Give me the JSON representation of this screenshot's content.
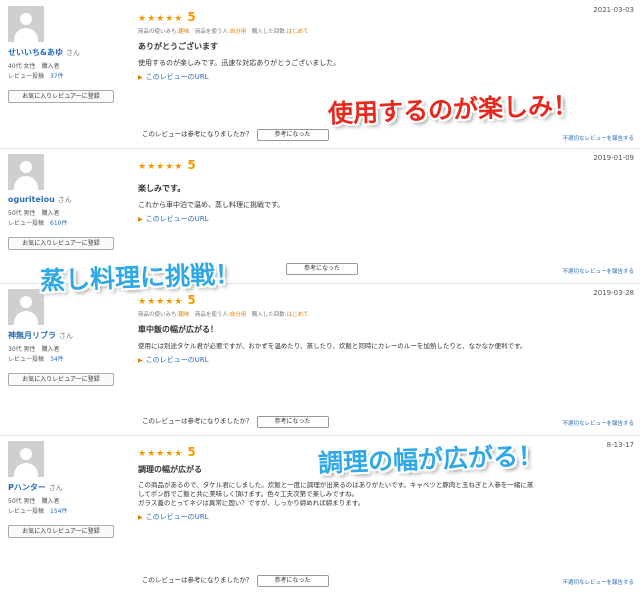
{
  "reviews": [
    {
      "user": "せいいち&あゆ",
      "san": "さん",
      "demo": "40代 女性　購入者",
      "posts_label": "レビュー投稿",
      "posts_count": "37件",
      "fav_button": "お気に入りレビュアーに登録",
      "stars": "★★★★★",
      "score": "5",
      "date": "2021-03-03",
      "usage_a": "商品の使いみち:",
      "usage_a_val": "趣味",
      "usage_b": "商品を使う人:",
      "usage_b_val": "自分用",
      "usage_c": "購入した回数:",
      "usage_c_val": "はじめて",
      "title": "ありがとうございます",
      "body": "使用するのが楽しみです。迅速な対応ありがとうございました。",
      "url_label": "このレビューのURL",
      "helpful_q": "このレビューは参考になりましたか？",
      "helpful_btn": "参考になった",
      "report": "不適切なレビューを報告する"
    },
    {
      "user": "oguriteiou",
      "san": "さん",
      "demo": "50代 男性　購入者",
      "posts_label": "レビュー投稿",
      "posts_count": "610件",
      "fav_button": "お気に入りレビュアーに登録",
      "stars": "★★★★★",
      "score": "5",
      "date": "2019-01-09",
      "title": "楽しみです。",
      "body": "これから車中泊で温め、蒸し料理に挑戦です。",
      "url_label": "このレビューのURL",
      "helpful_btn": "参考になった",
      "report": "不適切なレビューを報告する"
    },
    {
      "user": "神無月リブラ",
      "san": "さん",
      "demo": "30代 男性　購入者",
      "posts_label": "レビュー投稿",
      "posts_count": "34件",
      "fav_button": "お気に入りレビュアーに登録",
      "stars": "★★★★★",
      "score": "5",
      "date": "2019-03-28",
      "usage_a": "商品の使いみち:",
      "usage_a_val": "趣味",
      "usage_b": "商品を使う人:",
      "usage_b_val": "自分用",
      "usage_c": "購入した回数:",
      "usage_c_val": "はじめて",
      "title": "車中飯の幅が広がる！",
      "body": "使用には別途タケル君が必要ですが、おかずを温めたり、蒸したり、炊飯と同時にカレーのルーを加熱したりと、なかなか便利です。",
      "url_label": "このレビューのURL",
      "helpful_q": "このレビューは参考になりましたか？",
      "helpful_btn": "参考になった",
      "report": "不適切なレビューを報告する"
    },
    {
      "user": "Pハンター",
      "san": "さん",
      "demo": "50代 男性　購入者",
      "posts_label": "レビュー投稿",
      "posts_count": "154件",
      "fav_button": "お気に入りレビュアーに登録",
      "stars": "★★★★★",
      "score": "5",
      "date": "8-13-17",
      "title": "調理の幅が広がる",
      "body_lines": [
        "この商品があるので、タケル君にしました。炊飯と一度に調理が出来るのはありがたいです。キャベツと豚肉と玉ねぎと人参を一緒に蒸",
        "してポン酢でご飯と共に美味しく頂けます。色々工夫次第で楽しみですね。",
        "ガラス蓋のとってネジは異常に固い？ですが、しっかり締めれば締まります。"
      ],
      "url_label": "このレビューのURL",
      "helpful_q": "このレビューは参考になりましたか？",
      "helpful_btn": "参考になった",
      "report": "不適切なレビューを報告する"
    }
  ],
  "overlays": {
    "red": "使用するのが楽しみ！",
    "blue1": "蒸し料理に挑戦！",
    "blue2": "調理の幅が広がる！"
  },
  "colors": {
    "star": "#f39800",
    "link": "#2a6db5",
    "overlay_red": "#e8281c",
    "overlay_blue": "#2fa8e8"
  }
}
